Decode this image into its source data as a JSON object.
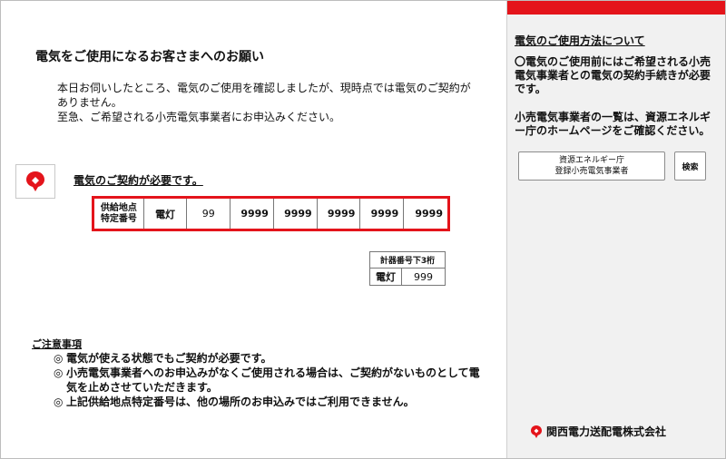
{
  "main": {
    "title": "電気をご使用になるお客さまへのお願い",
    "intro": [
      "本日お伺いしたところ、電気のご使用を確認しましたが、現時点では電気のご契約がありません。",
      "至急、ご希望される小売電気事業者にお申込みください。"
    ],
    "notice_title": "電気のご契約が必要です。",
    "supply_point": {
      "label_line1": "供給地点",
      "label_line2": "特定番号",
      "type": "電灯",
      "value1": "99",
      "numbers": [
        "9999",
        "9999",
        "9999",
        "9999",
        "9999"
      ]
    },
    "meter": {
      "header": "計器番号下3桁",
      "type": "電灯",
      "value": "999"
    },
    "caution_title": "ご注意事項",
    "caution_bullet": "◎",
    "caution_items": [
      "電気が使える状態でもご契約が必要です。",
      "小売電気事業者へのお申込みがなくご使用される場合は、ご契約がないものとして電気を止めさせていただきます。",
      "上記供給地点特定番号は、他の場所のお申込みではご利用できません。"
    ]
  },
  "sidebar": {
    "title": "電気のご使用方法について",
    "paragraph1": "〇電気のご使用前にはご希望される小売電気事業者との電気の契約手続きが必要です。",
    "paragraph2": "小売電気事業者の一覧は、資源エネルギー庁のホームページをご確認ください。",
    "directory_button_line1": "資源エネルギー庁",
    "directory_button_line2": "登録小売電気事業者",
    "search_button": "検索"
  },
  "footer": {
    "company_name": "関西電力送配電株式会社"
  },
  "colors": {
    "brand_red": "#e4141b",
    "sidebar_bg": "#f1f1f1"
  },
  "icons": {
    "brand_logo": "kansai-logo-icon",
    "company_logo": "company-logo-icon"
  }
}
